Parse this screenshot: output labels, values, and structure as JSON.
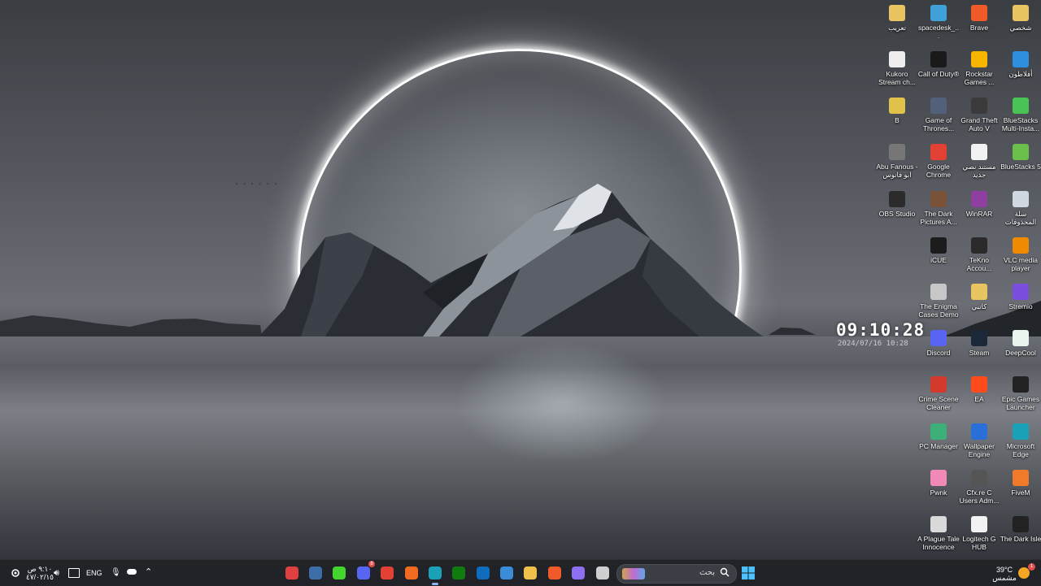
{
  "desktop": {
    "clock_widget": {
      "time": "09:10:28",
      "date": "2024/07/16 10:28"
    },
    "icons": [
      {
        "id": "tareeb",
        "label": "تعريب",
        "icon": "folder-icon",
        "color": "#e8c560"
      },
      {
        "id": "spacedesk",
        "label": "spacedesk_...",
        "icon": "spacedesk-icon",
        "color": "#3fa1d8"
      },
      {
        "id": "brave",
        "label": "Brave",
        "icon": "brave-icon",
        "color": "#f05a28"
      },
      {
        "id": "shakhsi",
        "label": "شخصي",
        "icon": "folder-icon",
        "color": "#e8c560"
      },
      {
        "id": "kukoro",
        "label": "Kukoro Stream ch...",
        "icon": "kukoro-icon",
        "color": "#eeeeee"
      },
      {
        "id": "cod",
        "label": "Call of Duty®",
        "icon": "call-of-duty-icon",
        "color": "#1a1a1a"
      },
      {
        "id": "rockstar",
        "label": "Rockstar Games ...",
        "icon": "rockstar-icon",
        "color": "#f7b500"
      },
      {
        "id": "aflatoon",
        "label": "أفلاطون",
        "icon": "aflatoon-icon",
        "color": "#2e8ee0"
      },
      {
        "id": "b",
        "label": "B",
        "icon": "folder-icon",
        "color": "#e0c14a"
      },
      {
        "id": "got",
        "label": "Game of Thrones...",
        "icon": "game-of-thrones-icon",
        "color": "#52607a"
      },
      {
        "id": "gta",
        "label": "Grand Theft Auto V",
        "icon": "gta-v-icon",
        "color": "#3b3b3b"
      },
      {
        "id": "bsmulti",
        "label": "BlueStacks Multi-Insta...",
        "icon": "bluestacks-multi-icon",
        "color": "#49c454"
      },
      {
        "id": "abufanous",
        "label": "Abu Fanous - ابو فانوس",
        "icon": "abu-fanous-icon",
        "color": "#777777"
      },
      {
        "id": "chrome",
        "label": "Google Chrome",
        "icon": "chrome-icon",
        "color": "#e34133"
      },
      {
        "id": "newdoc",
        "label": "مستند نصي جديد",
        "icon": "text-document-icon",
        "color": "#f2f2f2"
      },
      {
        "id": "bs5",
        "label": "BlueStacks 5",
        "icon": "bluestacks-icon",
        "color": "#6bc04b"
      },
      {
        "id": "obs",
        "label": "OBS Studio",
        "icon": "obs-icon",
        "color": "#2b2b2b"
      },
      {
        "id": "darkpictures",
        "label": "The Dark Pictures A...",
        "icon": "dark-pictures-icon",
        "color": "#7a5238"
      },
      {
        "id": "winrar",
        "label": "WinRAR",
        "icon": "winrar-icon",
        "color": "#8e3fa0"
      },
      {
        "id": "recycle",
        "label": "سلة المحذوفات",
        "icon": "recycle-bin-icon",
        "color": "#cfd8e0"
      },
      {
        "id": "icue",
        "label": "iCUE",
        "icon": "icue-icon",
        "color": "#1c1c1c"
      },
      {
        "id": "tekno",
        "label": "TeKno Accou...",
        "icon": "tekno-icon",
        "color": "#2a2a2a"
      },
      {
        "id": "vlc",
        "label": "VLC media player",
        "icon": "vlc-icon",
        "color": "#f08a00"
      },
      {
        "id": "enigma",
        "label": "The Enigma Cases Demo",
        "icon": "enigma-icon",
        "color": "#c7c7c7"
      },
      {
        "id": "katbi",
        "label": "كاتبي",
        "icon": "folder-icon",
        "color": "#e8c560"
      },
      {
        "id": "stremio",
        "label": "Stremio",
        "icon": "stremio-icon",
        "color": "#7b4ee0"
      },
      {
        "id": "discord",
        "label": "Discord",
        "icon": "discord-icon",
        "color": "#5865f2"
      },
      {
        "id": "steam",
        "label": "Steam",
        "icon": "steam-icon",
        "color": "#1b2838"
      },
      {
        "id": "deepcool",
        "label": "DeepCool",
        "icon": "deepcool-icon",
        "color": "#e9f5ef"
      },
      {
        "id": "crime",
        "label": "Crime Scene Cleaner",
        "icon": "crime-scene-icon",
        "color": "#d33a2c"
      },
      {
        "id": "ea",
        "label": "EA",
        "icon": "ea-icon",
        "color": "#ff4a1c"
      },
      {
        "id": "epic",
        "label": "Epic Games Launcher",
        "icon": "epic-games-icon",
        "color": "#222222"
      },
      {
        "id": "pcmanager",
        "label": "PC Manager",
        "icon": "pc-manager-icon",
        "color": "#3db07a"
      },
      {
        "id": "wallpaper",
        "label": "Wallpaper Engine",
        "icon": "wallpaper-engine-icon",
        "color": "#2a6fd8"
      },
      {
        "id": "edge",
        "label": "Microsoft Edge",
        "icon": "edge-icon",
        "color": "#1aa0b7"
      },
      {
        "id": "pwnk",
        "label": "Pwnk",
        "icon": "pwnk-icon",
        "color": "#f089b8"
      },
      {
        "id": "cfx",
        "label": "Cfx.re C Users Adm...",
        "icon": "shortcut-icon",
        "color": "#555555"
      },
      {
        "id": "fivem",
        "label": "FiveM",
        "icon": "fivem-icon",
        "color": "#f07a2a"
      },
      {
        "id": "plague",
        "label": "A Plague Tale Innocence",
        "icon": "plague-tale-icon",
        "color": "#dadada"
      },
      {
        "id": "logitech",
        "label": "Logitech G HUB",
        "icon": "logitech-icon",
        "color": "#f2f2f2"
      },
      {
        "id": "darkisle",
        "label": "The Dark Isle",
        "icon": "dark-isle-icon",
        "color": "#222222"
      }
    ]
  },
  "taskbar": {
    "search_placeholder": "بحث",
    "pinned": [
      {
        "id": "app-a",
        "icon": "spiral-app-icon",
        "color": "#e04040",
        "badge": ""
      },
      {
        "id": "steam",
        "icon": "steam-icon",
        "color": "#3d6ea8",
        "badge": ""
      },
      {
        "id": "razer",
        "icon": "razer-icon",
        "color": "#44d62c",
        "badge": ""
      },
      {
        "id": "discord",
        "icon": "discord-icon",
        "color": "#5865f2",
        "badge": "8"
      },
      {
        "id": "chrome",
        "icon": "chrome-icon",
        "color": "#e34133",
        "badge": ""
      },
      {
        "id": "affinity",
        "icon": "affinity-icon",
        "color": "#f26b21",
        "badge": ""
      },
      {
        "id": "edge",
        "icon": "edge-icon",
        "color": "#1aa0b7",
        "badge": ""
      },
      {
        "id": "xbox",
        "icon": "xbox-icon",
        "color": "#107c10",
        "badge": ""
      },
      {
        "id": "outlook",
        "icon": "outlook-icon",
        "color": "#0f6cbd",
        "badge": ""
      },
      {
        "id": "store",
        "icon": "store-icon",
        "color": "#3b8cd8",
        "badge": ""
      },
      {
        "id": "explorer",
        "icon": "file-explorer-icon",
        "color": "#f0c14a",
        "badge": ""
      },
      {
        "id": "brave",
        "icon": "brave-icon",
        "color": "#f05a28",
        "badge": ""
      },
      {
        "id": "copilot",
        "icon": "copilot-icon",
        "color": "#8d6ff0",
        "badge": ""
      },
      {
        "id": "taskview",
        "icon": "task-view-icon",
        "color": "#cfcfcf",
        "badge": ""
      }
    ],
    "start": "start-icon",
    "weather": {
      "temp": "39°C",
      "condition": "مشمس",
      "badge": "1"
    },
    "language": "ENG",
    "datetime": {
      "time": "٩:١٠ ص",
      "date": "٤٧/٠٢/١٥"
    }
  }
}
